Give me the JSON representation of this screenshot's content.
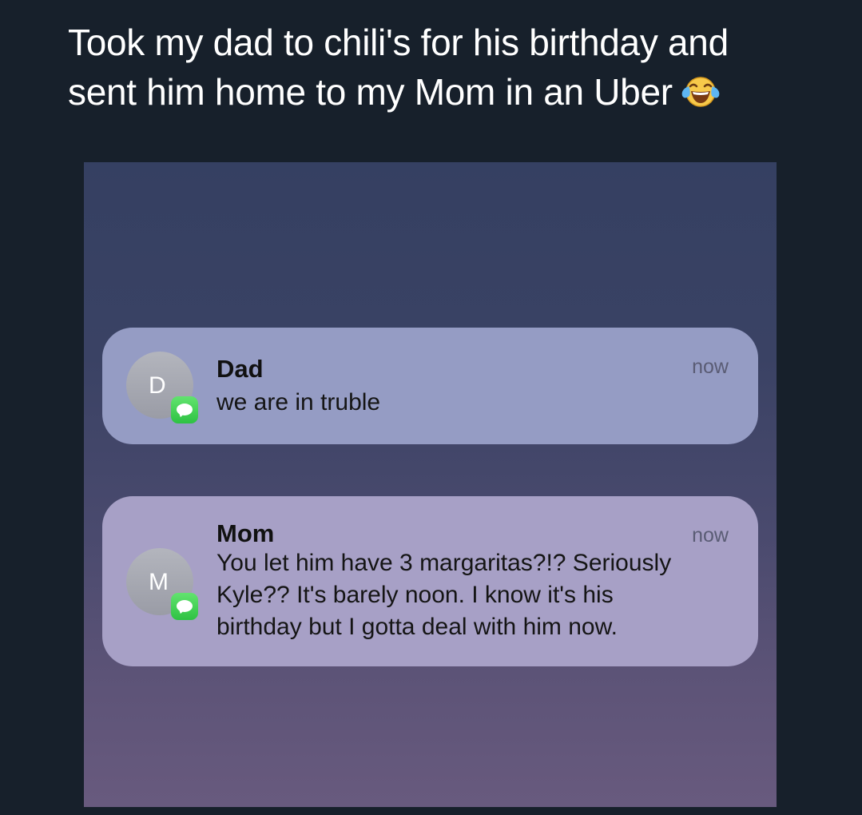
{
  "tweet": {
    "line1": "Took my dad to chili's for his birthday and",
    "line2": "sent him home to my Mom in an Uber",
    "emoji_icon": "face-with-tears-of-joy-emoji"
  },
  "notifications": [
    {
      "avatar_initial": "D",
      "sender": "Dad",
      "time": "now",
      "message": "we are in truble",
      "app_icon": "messages-icon"
    },
    {
      "avatar_initial": "M",
      "sender": "Mom",
      "time": "now",
      "message_lines": [
        "You let him have 3 margaritas?!? Seriously",
        "Kyle?? It's barely noon. I know it's his",
        "birthday but I gotta deal with him now."
      ],
      "app_icon": "messages-icon"
    }
  ],
  "colors": {
    "page_background": "#17202b",
    "notification_dad": "#959cc4",
    "notification_mom": "#a7a0c6",
    "messages_green": "#34c74a"
  }
}
